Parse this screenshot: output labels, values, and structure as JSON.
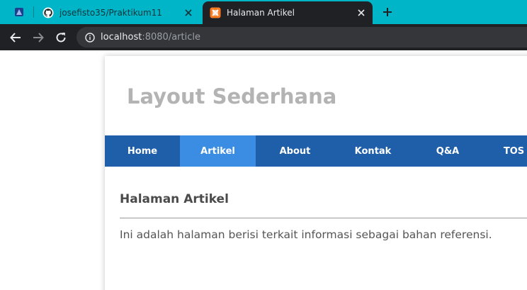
{
  "browser": {
    "tabs": [
      {
        "title": "josefisto35/Praktikum11",
        "favicon": "github-icon",
        "active": false
      },
      {
        "title": "Halaman Artikel",
        "favicon": "xampp-icon",
        "active": true
      }
    ],
    "url_host": "localhost",
    "url_rest": ":8080/article"
  },
  "site": {
    "title": "Layout Sederhana",
    "nav": [
      {
        "label": "Home",
        "active": false
      },
      {
        "label": "Artikel",
        "active": true
      },
      {
        "label": "About",
        "active": false
      },
      {
        "label": "Kontak",
        "active": false
      },
      {
        "label": "Q&A",
        "active": false
      },
      {
        "label": "TOS",
        "active": false
      }
    ]
  },
  "content": {
    "heading": "Halaman Artikel",
    "body": "Ini adalah halaman berisi terkait informasi sebagai bahan referensi."
  },
  "colors": {
    "tabstrip": "#00b5c7",
    "nav_bg": "#1f5faa",
    "nav_active": "#3b8de3",
    "title_text": "#b3b3b3"
  }
}
